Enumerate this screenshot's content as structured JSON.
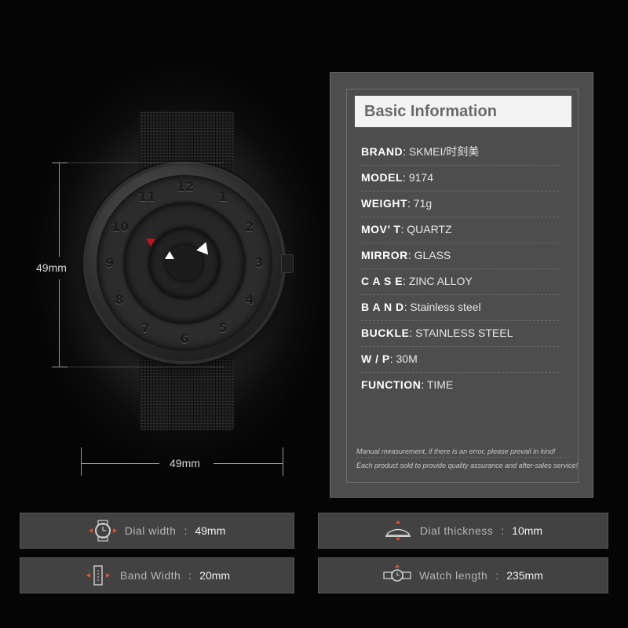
{
  "dimensions": {
    "height_label": "49mm",
    "width_label": "49mm"
  },
  "dial_numbers": [
    "12",
    "1",
    "2",
    "3",
    "4",
    "5",
    "6",
    "7",
    "8",
    "9",
    "10",
    "11"
  ],
  "basic_info": {
    "title": "Basic Information",
    "rows": [
      {
        "label": "BRAND",
        "sep": ":",
        "value": "SKMEI/时刻美"
      },
      {
        "label": "MODEL",
        "sep": ":",
        "value": "9174"
      },
      {
        "label": "WEIGHT",
        "sep": ":",
        "value": "71g"
      },
      {
        "label": "MOV’ T",
        "sep": ":",
        "value": "QUARTZ"
      },
      {
        "label": "MIRROR",
        "sep": ":",
        "value": "GLASS"
      },
      {
        "label": "C A S E",
        "sep": ":",
        "value": "ZINC ALLOY"
      },
      {
        "label": "B A N D",
        "sep": ":",
        "value": "Stainless steel"
      },
      {
        "label": "BUCKLE",
        "sep": ":",
        "value": "STAINLESS STEEL"
      },
      {
        "label": "W / P",
        "sep": ":",
        "value": "30M"
      },
      {
        "label": "FUNCTION",
        "sep": ":",
        "value": "TIME"
      }
    ],
    "note_line1": "Manual measurement, if there is an error, please prevail in kind!",
    "note_line2": "Each product sold to provide quality assurance and after-sales service!"
  },
  "specs": {
    "dial_width": {
      "label": "Dial width",
      "sep": ":",
      "value": "49mm",
      "icon": "dial-width-icon"
    },
    "dial_thickness": {
      "label": "Dial thickness",
      "sep": ":",
      "value": "10mm",
      "icon": "dial-thickness-icon"
    },
    "band_width": {
      "label": "Band Width",
      "sep": ":",
      "value": "20mm",
      "icon": "band-width-icon"
    },
    "watch_length": {
      "label": "Watch length",
      "sep": ":",
      "value": "235mm",
      "icon": "watch-length-icon"
    }
  },
  "colors": {
    "accent": "#e2542f",
    "pointer_red": "#c0141c",
    "panel": "#4d4d4d"
  }
}
